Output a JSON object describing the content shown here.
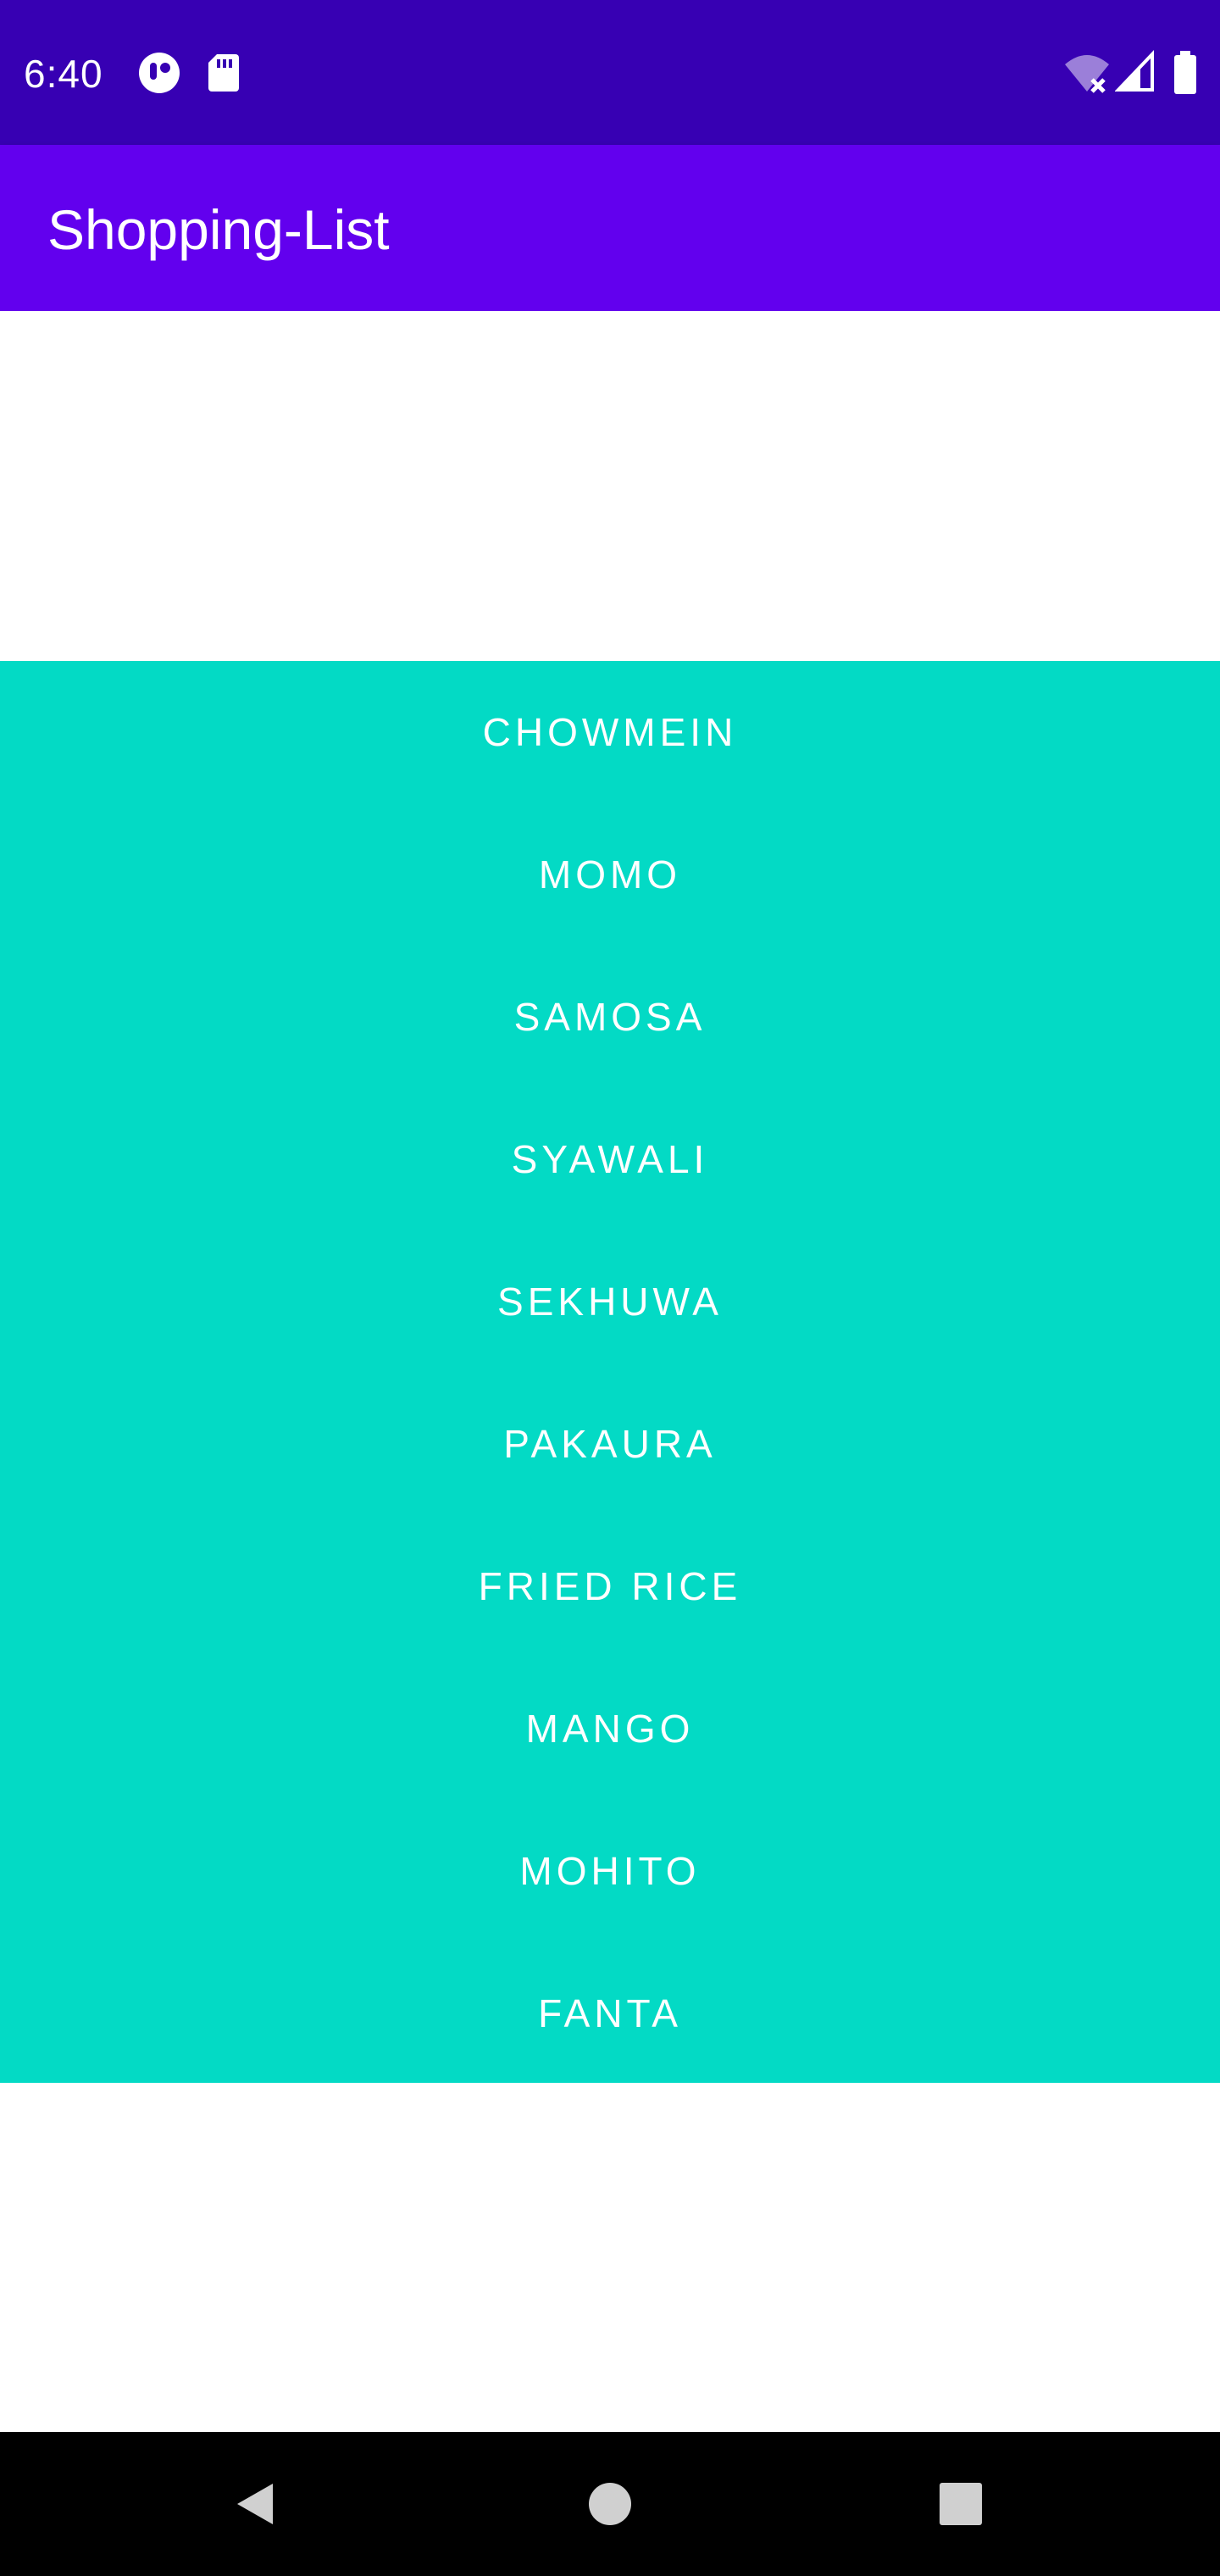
{
  "status_bar": {
    "time": "6:40",
    "background": "#3700b3",
    "icons_left": [
      "assistant-icon",
      "sd-card-icon"
    ],
    "icons_right": [
      "wifi-off-icon",
      "cell-signal-icon",
      "battery-icon"
    ]
  },
  "app_bar": {
    "title": "Shopping-List",
    "background": "#6200ee"
  },
  "list": {
    "background": "#03dac5",
    "items": [
      {
        "label": "CHOWMEIN"
      },
      {
        "label": "MOMO"
      },
      {
        "label": "SAMOSA"
      },
      {
        "label": "SYAWALI"
      },
      {
        "label": "SEKHUWA"
      },
      {
        "label": "PAKAURA"
      },
      {
        "label": "FRIED RICE"
      },
      {
        "label": "MANGO"
      },
      {
        "label": "MOHITO"
      },
      {
        "label": "FANTA"
      }
    ]
  },
  "nav_bar": {
    "buttons": [
      "back-icon",
      "home-icon",
      "recents-icon"
    ]
  }
}
